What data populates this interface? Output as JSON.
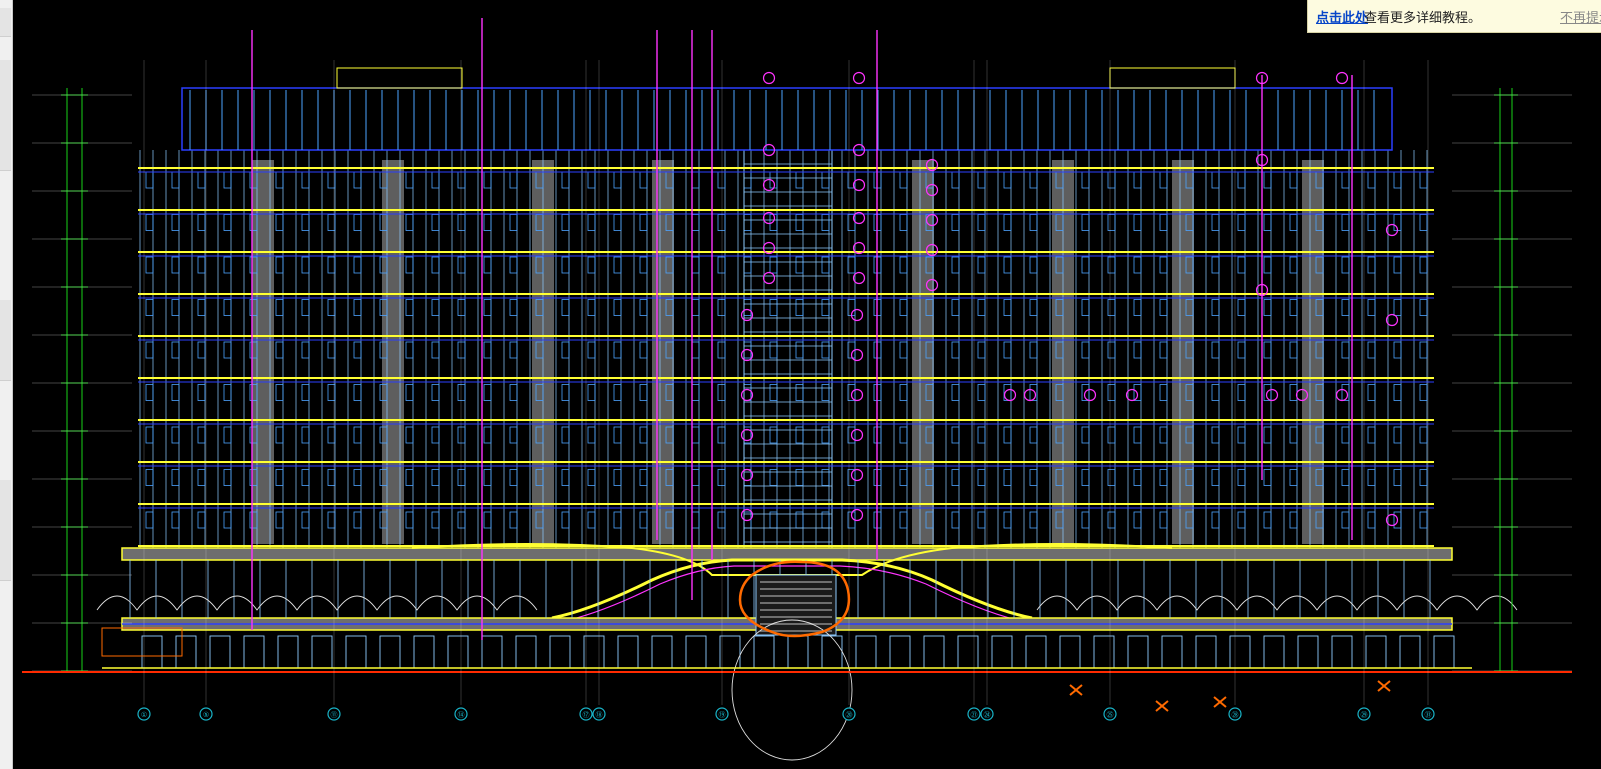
{
  "notice": {
    "link_text": "点击此处",
    "message": "查看更多详细教程。",
    "dismiss_text": "不再提示"
  },
  "drawing": {
    "background": "#000000",
    "colors": {
      "ground_line": "#ff2a00",
      "floor_lines": "#ffff33",
      "facade_grid": "#8ecbff",
      "window_frames": "#4da3ff",
      "roof_outline": "#2b3fff",
      "column_bands": "#6e6e6e",
      "dimension_lines": "#19d219",
      "axis_bubbles": "#19b4c8",
      "leader_lines": "#ff33ff",
      "revision_cloud": "#ff6a00",
      "landscape_trees": "#e0e0e0"
    },
    "axis_labels": [
      "①",
      "⑤",
      "⑪",
      "⑭",
      "⑰",
      "⑱",
      "⑲",
      "⑳",
      "㉑",
      "㉔",
      "㉕",
      "㉘",
      "㉙",
      "㉛",
      "㉜",
      "㉟",
      "㊱"
    ]
  }
}
